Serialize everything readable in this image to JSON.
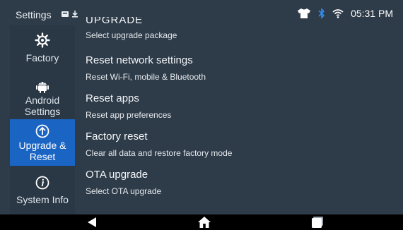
{
  "status_bar": {
    "title": "Settings",
    "time": "05:31 PM",
    "icons": [
      "notification-icon",
      "download-icon",
      "tshirt-icon",
      "bluetooth-icon",
      "wifi-icon"
    ]
  },
  "sidebar": {
    "items": [
      {
        "label": "Factory",
        "icon": "gear-icon"
      },
      {
        "label": "Android\nSettings",
        "icon": "android-icon"
      },
      {
        "label": "Upgrade &\nReset",
        "icon": "upgrade-icon",
        "active": true
      },
      {
        "label": "System Info",
        "icon": "info-icon"
      }
    ]
  },
  "content": {
    "partial_title": "UPGRADE",
    "items": [
      {
        "title": "",
        "subtitle": "Select upgrade package"
      },
      {
        "title": "Reset network settings",
        "subtitle": "Reset Wi-Fi, mobile & Bluetooth"
      },
      {
        "title": "Reset apps",
        "subtitle": "Reset app preferences"
      },
      {
        "title": "Factory reset",
        "subtitle": "Clear all data and restore factory mode"
      },
      {
        "title": "OTA upgrade",
        "subtitle": "Select OTA upgrade"
      }
    ]
  },
  "nav_bar": {
    "buttons": [
      "back-icon",
      "home-icon",
      "recents-icon"
    ]
  },
  "colors": {
    "background": "#2e3b48",
    "sidebar": "#2a3744",
    "active": "#1a64c4",
    "bluetooth": "#2f8cf0"
  }
}
